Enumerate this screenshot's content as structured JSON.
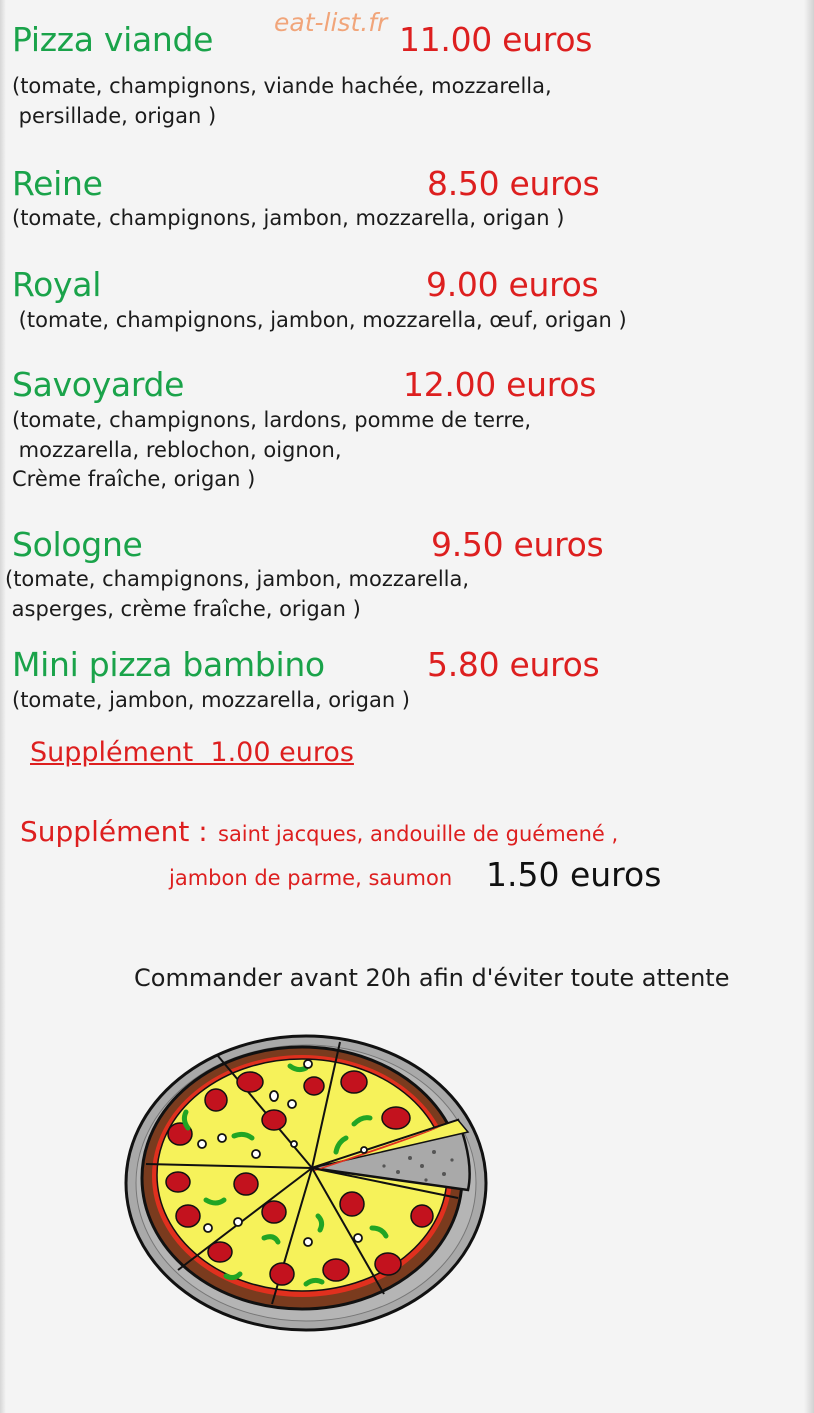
{
  "watermark": "eat-list.fr",
  "menu": {
    "items": [
      {
        "name": "Pizza viande",
        "price": "11.00 euros",
        "description": [
          "(tomate, champignons, viande hachée, mozzarella,",
          " persillade, origan )"
        ]
      },
      {
        "name": "Reine",
        "price": "8.50 euros",
        "description": [
          "(tomate, champignons, jambon, mozzarella, origan )"
        ]
      },
      {
        "name": "Royal",
        "price": "9.00 euros",
        "description": [
          " (tomate, champignons, jambon, mozzarella, œuf, origan )"
        ]
      },
      {
        "name": "Savoyarde",
        "price": "12.00 euros",
        "description": [
          "(tomate, champignons, lardons, pomme de terre,",
          " mozzarella, reblochon, oignon,",
          "Crème fraîche, origan )"
        ]
      },
      {
        "name": "Sologne",
        "price": "9.50 euros",
        "description": [
          "(tomate, champignons, jambon, mozzarella,",
          " asperges, crème fraîche, origan )"
        ]
      },
      {
        "name": "Mini pizza bambino",
        "price": "5.80 euros",
        "description": [
          "(tomate, jambon, mozzarella, origan )"
        ]
      }
    ]
  },
  "supplements": {
    "basic": "Supplément  1.00 euros",
    "premium_label": "Supplément :",
    "premium_items_line1": "saint jacques, andouille de guémené ,",
    "premium_items_line2": "jambon de parme, saumon",
    "premium_price": "1.50 euros"
  },
  "notice": "Commander avant 20h afin d'éviter toute attente",
  "illustration": {
    "icon": "pizza-icon",
    "colors": {
      "plate": "#a9a9a9",
      "crust": "#7a3b1e",
      "cheese": "#f6f25a",
      "sauce": "#e0301e",
      "pepperoni": "#c3121e",
      "pepper": "#21a524",
      "olive": "#ffffff",
      "outline": "#111111"
    }
  },
  "colors": {
    "background": "#f4f4f4",
    "item_name": "#1aa34a",
    "price": "#dd1f1f",
    "description": "#1b1b1b",
    "watermark": "#f1a57a"
  }
}
